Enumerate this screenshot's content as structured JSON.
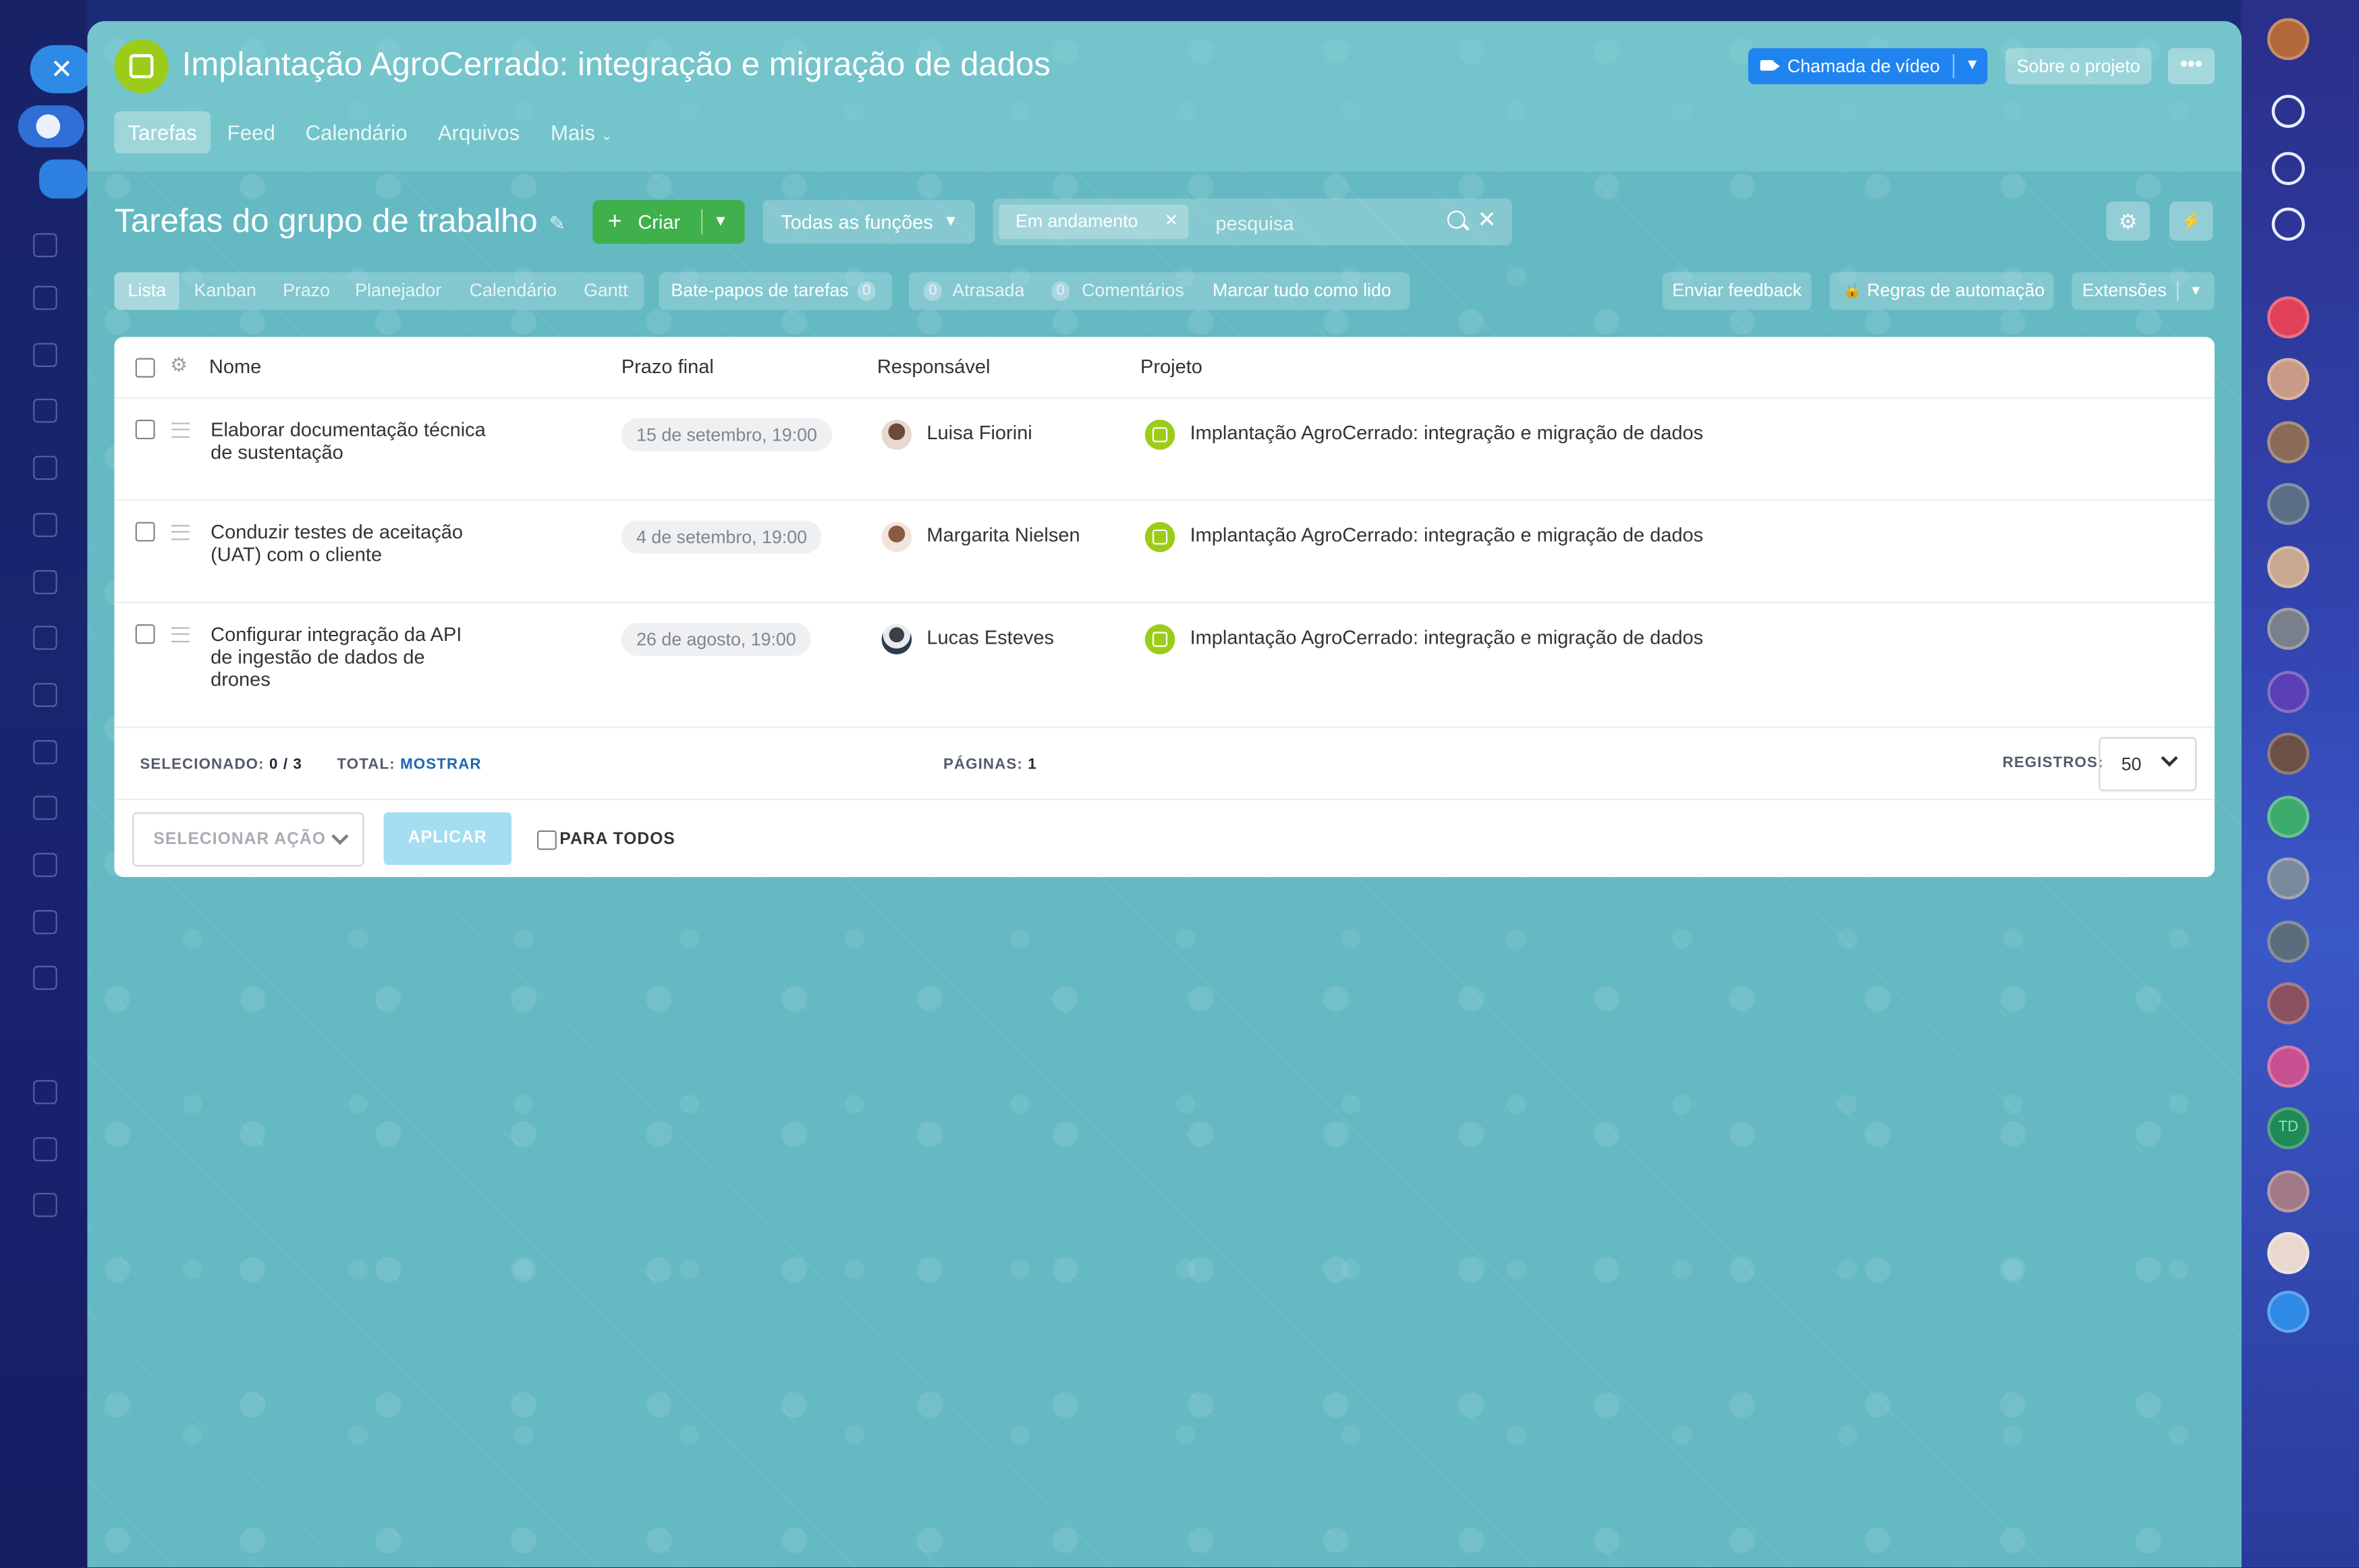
{
  "header": {
    "title": "Implantação AgroCerrado: integração e migração de dados",
    "video_call_label": "Chamada de vídeo",
    "about_label": "Sobre o projeto",
    "more_label": "•••"
  },
  "tabs": [
    "Tarefas",
    "Feed",
    "Calendário",
    "Arquivos",
    "Mais"
  ],
  "toolbar": {
    "page_title": "Tarefas do grupo de trabalho",
    "create_label": "Criar",
    "roles_label": "Todas as funções",
    "filter_chip": "Em andamento",
    "search_placeholder": "pesquisa"
  },
  "views": [
    "Lista",
    "Kanban",
    "Prazo",
    "Planejador",
    "Calendário",
    "Gantt"
  ],
  "counters": {
    "chats_label": "Bate-papos de tarefas",
    "chats_count": "0",
    "overdue_count": "0",
    "overdue_label": "Atrasada",
    "comments_count": "0",
    "comments_label": "Comentários",
    "mark_read": "Marcar tudo como lido"
  },
  "right_actions": {
    "feedback": "Enviar feedback",
    "automation": "Regras de automação",
    "extensions": "Extensões"
  },
  "table": {
    "columns": {
      "name": "Nome",
      "deadline": "Prazo final",
      "responsible": "Responsável",
      "project": "Projeto"
    },
    "rows": [
      {
        "name": "Elaborar documentação técnica de sustentação",
        "deadline": "15 de setembro, 19:00",
        "responsible": "Luisa Fiorini",
        "project": "Implantação AgroCerrado: integração e migração de dados"
      },
      {
        "name": "Conduzir testes de aceitação (UAT) com o cliente",
        "deadline": "4 de setembro, 19:00",
        "responsible": "Margarita Nielsen",
        "project": "Implantação AgroCerrado: integração e migração de dados"
      },
      {
        "name": "Configurar integração da API de ingestão de dados de drones",
        "deadline": "26 de agosto, 19:00",
        "responsible": "Lucas Esteves",
        "project": "Implantação AgroCerrado: integração e migração de dados"
      }
    ]
  },
  "footer": {
    "selected_label": "SELECIONADO:",
    "selected_value": "0 / 3",
    "total_label": "TOTAL:",
    "total_link": "MOSTRAR",
    "pages_label": "PÁGINAS:",
    "pages_value": "1",
    "records_label": "REGISTROS:",
    "records_value": "50",
    "action_placeholder": "SELECIONAR AÇÃO",
    "apply_label": "APLICAR",
    "for_all_label": "PARA TODOS"
  },
  "right_sidebar": {
    "initials_avatar": "TD"
  },
  "colors": {
    "accent_blue": "#1f84f0",
    "create_green": "#3fb04c",
    "project_green": "#9ccc1a",
    "panel_bg": "#64b9c3"
  }
}
